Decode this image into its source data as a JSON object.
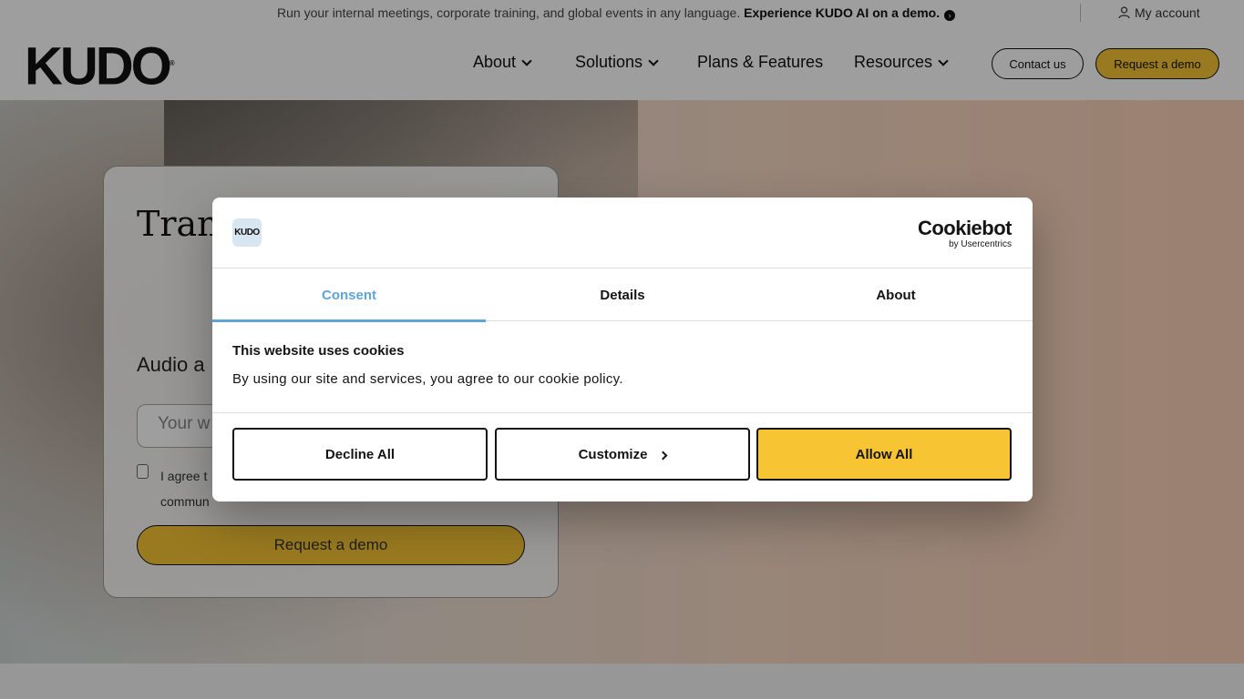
{
  "announcement": {
    "message": "Run your internal meetings, corporate training, and global events in any language.",
    "cta": "Experience KUDO AI on a demo.",
    "account": "My account"
  },
  "header": {
    "logo": "KUDO",
    "nav": [
      "About",
      "Solutions",
      "Plans & Features",
      "Resources"
    ],
    "contact_label": "Contact us",
    "demo_label": "Request a demo"
  },
  "hero": {
    "title": "Tran prod live",
    "subtitle": "Audio a",
    "input_placeholder": "Your w",
    "checkbox_label_line1": "I agree t",
    "checkbox_label_line2": "commun",
    "submit_label": "Request a demo"
  },
  "cookie_dialog": {
    "logo_text": "KUDO",
    "brand_name": "Cookiebot",
    "brand_by": "by Usercentrics",
    "tabs": [
      "Consent",
      "Details",
      "About"
    ],
    "active_tab": "Consent",
    "heading": "This website uses cookies",
    "body": "By using our site and services, you agree to our cookie policy.",
    "buttons": {
      "decline": "Decline All",
      "customize": "Customize",
      "allow": "Allow All"
    }
  },
  "colors": {
    "accent_yellow": "#f7c534",
    "tab_active": "#5fa5d8"
  }
}
